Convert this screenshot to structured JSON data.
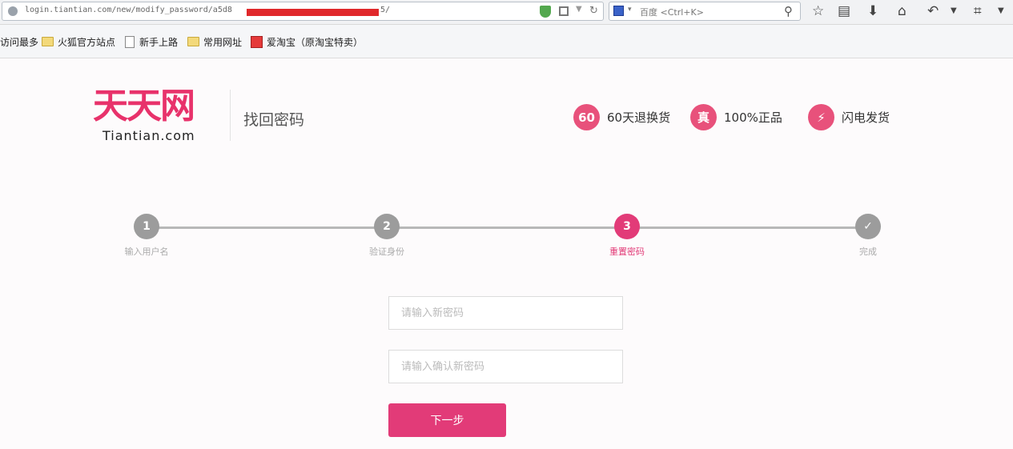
{
  "browser": {
    "url_prefix": "login.tiantian.com/new/modify_password/a5d8",
    "url_suffix": "5/",
    "search_engine": "百度",
    "search_shortcut": "<Ctrl+K>",
    "bookmarks": [
      {
        "label": "访问最多",
        "icon": "none"
      },
      {
        "label": "火狐官方站点",
        "icon": "folder"
      },
      {
        "label": "新手上路",
        "icon": "page"
      },
      {
        "label": "常用网址",
        "icon": "folder"
      },
      {
        "label": "爱淘宝（原淘宝特卖）",
        "icon": "taobao"
      }
    ]
  },
  "header": {
    "logo_cn": "天天网",
    "logo_en": "Tiantian.com",
    "page_title": "找回密码",
    "features": [
      {
        "badge": "60",
        "label": "60天退换货"
      },
      {
        "badge": "真",
        "label": "100%正品"
      },
      {
        "badge": "⚡",
        "label": "闪电发货"
      }
    ]
  },
  "steps": {
    "current": 3,
    "items": [
      {
        "number": "1",
        "label": "输入用户名"
      },
      {
        "number": "2",
        "label": "验证身份"
      },
      {
        "number": "3",
        "label": "重置密码"
      },
      {
        "number": "✓",
        "label": "完成"
      }
    ]
  },
  "form": {
    "new_password_placeholder": "请输入新密码",
    "confirm_password_placeholder": "请输入确认新密码",
    "next_label": "下一步"
  },
  "colors": {
    "brand_pink": "#e8326b",
    "active_step": "#e23b78",
    "inactive_step": "#9c9c9c"
  }
}
